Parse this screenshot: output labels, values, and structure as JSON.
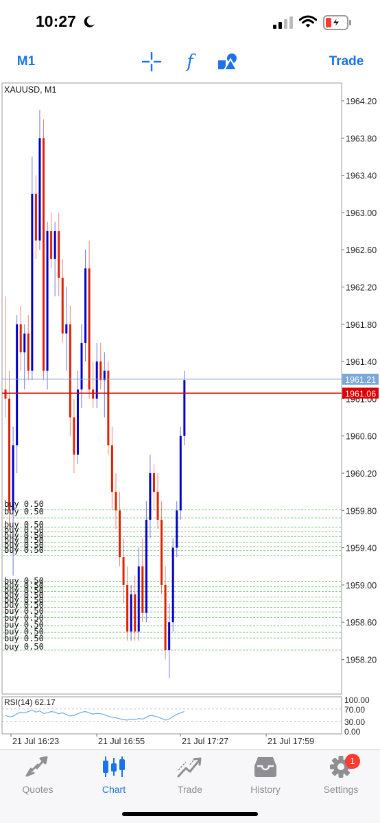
{
  "status_bar": {
    "time": "10:27"
  },
  "toolbar": {
    "timeframe": "M1",
    "trade_label": "Trade",
    "indicator_glyph": "f"
  },
  "chart": {
    "symbol_label": "XAUUSD, M1",
    "price_axis": [
      "1964.20",
      "1963.80",
      "1963.40",
      "1963.00",
      "1962.60",
      "1962.20",
      "1961.80",
      "1961.40",
      "1961.00",
      "1960.60",
      "1960.20",
      "1959.80",
      "1959.40",
      "1959.00",
      "1958.60",
      "1958.20"
    ],
    "bid_price": "1961.21",
    "ask_price": "1961.06",
    "time_axis": [
      "21 Jul 16:23",
      "21 Jul 16:55",
      "21 Jul 17:27",
      "21 Jul 17:59"
    ],
    "order_label": "buy 0.50",
    "rsi_label": "RSI(14) 62.17",
    "rsi_axis": [
      "100.00",
      "70.00",
      "30.00",
      "0.00"
    ],
    "colors": {
      "bull": "#0000cc",
      "bear": "#dd2200",
      "ask_line": "#dd0000",
      "bid_line": "#7aa6d8",
      "orders": "#7ec47e",
      "rsi": "#6aaae8"
    }
  },
  "chart_data": {
    "type": "candlestick",
    "title": "XAUUSD, M1",
    "xlabel": "",
    "ylabel": "",
    "x_ticks": [
      "21 Jul 16:23",
      "21 Jul 16:55",
      "21 Jul 17:27",
      "21 Jul 17:59"
    ],
    "ylim": [
      1957.9,
      1964.4
    ],
    "candles": [
      {
        "o": 1961.1,
        "h": 1962.1,
        "l": 1960.8,
        "c": 1961.0
      },
      {
        "o": 1961.0,
        "h": 1961.3,
        "l": 1959.6,
        "c": 1959.8
      },
      {
        "o": 1959.8,
        "h": 1960.7,
        "l": 1959.1,
        "c": 1960.5
      },
      {
        "o": 1960.5,
        "h": 1961.9,
        "l": 1960.2,
        "c": 1961.8
      },
      {
        "o": 1961.8,
        "h": 1962.0,
        "l": 1961.3,
        "c": 1961.5
      },
      {
        "o": 1961.5,
        "h": 1961.8,
        "l": 1961.1,
        "c": 1961.7
      },
      {
        "o": 1961.7,
        "h": 1961.9,
        "l": 1961.2,
        "c": 1961.3
      },
      {
        "o": 1961.3,
        "h": 1963.6,
        "l": 1961.2,
        "c": 1963.2
      },
      {
        "o": 1963.2,
        "h": 1963.4,
        "l": 1962.5,
        "c": 1962.7
      },
      {
        "o": 1962.7,
        "h": 1964.1,
        "l": 1962.6,
        "c": 1963.8
      },
      {
        "o": 1963.8,
        "h": 1964.0,
        "l": 1961.2,
        "c": 1961.3
      },
      {
        "o": 1961.3,
        "h": 1962.9,
        "l": 1961.1,
        "c": 1962.8
      },
      {
        "o": 1962.8,
        "h": 1963.0,
        "l": 1962.4,
        "c": 1962.5
      },
      {
        "o": 1962.5,
        "h": 1962.9,
        "l": 1962.1,
        "c": 1962.8
      },
      {
        "o": 1962.8,
        "h": 1963.0,
        "l": 1962.1,
        "c": 1962.3
      },
      {
        "o": 1962.3,
        "h": 1962.5,
        "l": 1961.6,
        "c": 1961.7
      },
      {
        "o": 1961.7,
        "h": 1962.2,
        "l": 1961.3,
        "c": 1961.8
      },
      {
        "o": 1961.8,
        "h": 1962.0,
        "l": 1960.6,
        "c": 1960.8
      },
      {
        "o": 1960.8,
        "h": 1961.0,
        "l": 1960.2,
        "c": 1960.4
      },
      {
        "o": 1960.4,
        "h": 1961.3,
        "l": 1960.3,
        "c": 1961.1
      },
      {
        "o": 1961.1,
        "h": 1961.8,
        "l": 1960.9,
        "c": 1961.6
      },
      {
        "o": 1961.6,
        "h": 1962.6,
        "l": 1961.4,
        "c": 1962.4
      },
      {
        "o": 1962.4,
        "h": 1962.7,
        "l": 1961.0,
        "c": 1961.1
      },
      {
        "o": 1961.1,
        "h": 1961.4,
        "l": 1960.9,
        "c": 1961.0
      },
      {
        "o": 1961.0,
        "h": 1961.6,
        "l": 1960.9,
        "c": 1961.4
      },
      {
        "o": 1961.4,
        "h": 1961.6,
        "l": 1961.1,
        "c": 1961.2
      },
      {
        "o": 1961.2,
        "h": 1961.5,
        "l": 1960.8,
        "c": 1961.3
      },
      {
        "o": 1961.3,
        "h": 1961.4,
        "l": 1960.4,
        "c": 1960.5
      },
      {
        "o": 1960.5,
        "h": 1960.7,
        "l": 1959.8,
        "c": 1960.0
      },
      {
        "o": 1960.0,
        "h": 1960.2,
        "l": 1959.6,
        "c": 1959.8
      },
      {
        "o": 1959.8,
        "h": 1960.0,
        "l": 1959.2,
        "c": 1959.3
      },
      {
        "o": 1959.3,
        "h": 1959.5,
        "l": 1958.8,
        "c": 1959.0
      },
      {
        "o": 1959.0,
        "h": 1959.2,
        "l": 1958.4,
        "c": 1958.5
      },
      {
        "o": 1958.5,
        "h": 1959.0,
        "l": 1958.4,
        "c": 1958.9
      },
      {
        "o": 1958.9,
        "h": 1959.1,
        "l": 1958.4,
        "c": 1958.5
      },
      {
        "o": 1958.5,
        "h": 1959.4,
        "l": 1958.4,
        "c": 1959.2
      },
      {
        "o": 1959.2,
        "h": 1959.5,
        "l": 1958.6,
        "c": 1958.7
      },
      {
        "o": 1958.7,
        "h": 1959.9,
        "l": 1958.6,
        "c": 1959.7
      },
      {
        "o": 1959.7,
        "h": 1960.4,
        "l": 1959.5,
        "c": 1960.2
      },
      {
        "o": 1960.2,
        "h": 1960.3,
        "l": 1959.8,
        "c": 1960.0
      },
      {
        "o": 1960.0,
        "h": 1960.2,
        "l": 1959.6,
        "c": 1959.7
      },
      {
        "o": 1959.7,
        "h": 1959.9,
        "l": 1958.9,
        "c": 1959.0
      },
      {
        "o": 1959.0,
        "h": 1959.2,
        "l": 1958.2,
        "c": 1958.3
      },
      {
        "o": 1958.3,
        "h": 1958.8,
        "l": 1958.0,
        "c": 1958.6
      },
      {
        "o": 1958.6,
        "h": 1959.5,
        "l": 1958.5,
        "c": 1959.4
      },
      {
        "o": 1959.4,
        "h": 1959.9,
        "l": 1959.3,
        "c": 1959.8
      },
      {
        "o": 1959.8,
        "h": 1960.7,
        "l": 1959.7,
        "c": 1960.6
      },
      {
        "o": 1960.6,
        "h": 1961.3,
        "l": 1960.5,
        "c": 1961.2
      }
    ],
    "orders": [
      1959.81,
      1959.72,
      1959.62,
      1959.57,
      1959.52,
      1959.46,
      1959.41,
      1959.37,
      1959.32,
      1959.04,
      1958.98,
      1958.93,
      1958.87,
      1958.82,
      1958.76,
      1958.71,
      1958.65,
      1958.56,
      1958.49,
      1958.43,
      1958.3
    ],
    "rsi": {
      "name": "RSI(14)",
      "last": 62.17,
      "levels": [
        70,
        30
      ],
      "ylim": [
        0,
        100
      ],
      "values": [
        50,
        45,
        47,
        55,
        60,
        58,
        62,
        66,
        60,
        64,
        56,
        58,
        62,
        60,
        55,
        58,
        52,
        48,
        50,
        55,
        60,
        62,
        58,
        54,
        56,
        55,
        52,
        47,
        44,
        42,
        39,
        36,
        35,
        38,
        36,
        40,
        38,
        44,
        50,
        48,
        45,
        40,
        35,
        38,
        46,
        53,
        58,
        62
      ]
    }
  },
  "tabs": [
    {
      "id": "quotes",
      "label": "Quotes",
      "active": false
    },
    {
      "id": "chart",
      "label": "Chart",
      "active": true
    },
    {
      "id": "trade",
      "label": "Trade",
      "active": false
    },
    {
      "id": "history",
      "label": "History",
      "active": false
    },
    {
      "id": "settings",
      "label": "Settings",
      "active": false,
      "badge": "1"
    }
  ]
}
